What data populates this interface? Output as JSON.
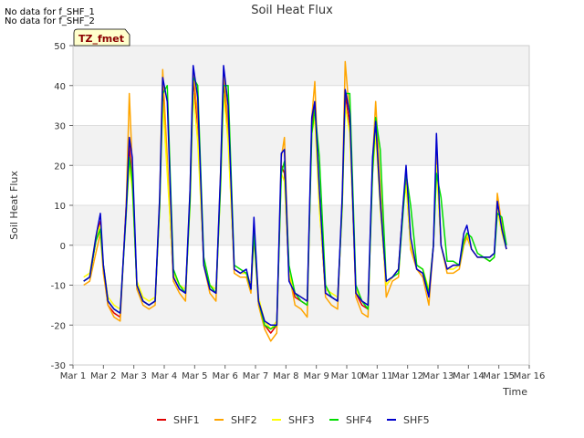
{
  "notices": [
    "No data for f_SHF_1",
    "No data for f_SHF_2"
  ],
  "badge": "TZ_fmet",
  "chart_data": {
    "type": "line",
    "title": "Soil Heat Flux",
    "xlabel": "Time",
    "ylabel": "Soil Heat Flux",
    "xlim": [
      1,
      16
    ],
    "ylim": [
      -30,
      50
    ],
    "xticks": [
      1,
      2,
      3,
      4,
      5,
      6,
      7,
      8,
      9,
      10,
      11,
      12,
      13,
      14,
      15,
      16
    ],
    "xtick_labels": [
      "Mar 1",
      "Mar 2",
      "Mar 3",
      "Mar 4",
      "Mar 5",
      "Mar 6",
      "Mar 7",
      "Mar 8",
      "Mar 9",
      "Mar 10",
      "Mar 11",
      "Mar 12",
      "Mar 13",
      "Mar 14",
      "Mar 15",
      "Mar 16"
    ],
    "yticks": [
      -30,
      -20,
      -10,
      0,
      10,
      20,
      30,
      40,
      50
    ],
    "ytick_labels": [
      "-30",
      "-20",
      "-10",
      "0",
      "10",
      "20",
      "30",
      "40",
      "50"
    ],
    "grid": true,
    "legend_position": "bottom",
    "x": [
      1.35,
      1.55,
      1.75,
      1.9,
      2.0,
      2.15,
      2.35,
      2.55,
      2.75,
      2.85,
      2.95,
      3.1,
      3.3,
      3.5,
      3.7,
      3.85,
      3.95,
      4.1,
      4.3,
      4.5,
      4.7,
      4.85,
      4.95,
      5.1,
      5.3,
      5.5,
      5.7,
      5.85,
      5.95,
      6.1,
      6.3,
      6.5,
      6.7,
      6.85,
      6.95,
      7.1,
      7.3,
      7.5,
      7.7,
      7.85,
      7.95,
      8.1,
      8.3,
      8.5,
      8.7,
      8.85,
      8.95,
      9.1,
      9.3,
      9.5,
      9.7,
      9.85,
      9.95,
      10.1,
      10.3,
      10.5,
      10.7,
      10.85,
      10.95,
      11.1,
      11.3,
      11.5,
      11.7,
      11.85,
      11.95,
      12.1,
      12.3,
      12.5,
      12.7,
      12.85,
      12.95,
      13.1,
      13.3,
      13.5,
      13.7,
      13.85,
      13.95,
      14.1,
      14.3,
      14.5,
      14.7,
      14.85,
      14.95,
      15.1,
      15.25
    ],
    "series": [
      {
        "name": "SHF1",
        "color": "#e00000",
        "values": [
          -9,
          -8,
          1,
          6,
          -6,
          -15,
          -17,
          -18,
          10,
          25,
          16,
          -10,
          -14,
          -15,
          -14,
          10,
          40,
          20,
          -8,
          -11,
          -12,
          12,
          42,
          30,
          -5,
          -11,
          -12,
          16,
          42,
          28,
          -6,
          -7,
          -7,
          -10,
          5,
          -14,
          -20,
          -22,
          -20,
          20,
          18,
          -8,
          -13,
          -14,
          -15,
          30,
          36,
          10,
          -12,
          -13,
          -14,
          10,
          38,
          30,
          -12,
          -15,
          -16,
          20,
          30,
          10,
          -10,
          -8,
          -6,
          10,
          16,
          0,
          -6,
          -7,
          -12,
          0,
          22,
          0,
          -6,
          -5,
          -5,
          1,
          3,
          -1,
          -3,
          -3,
          -3,
          -2,
          10,
          4,
          -1
        ]
      },
      {
        "name": "SHF2",
        "color": "#ffa500",
        "values": [
          -10,
          -9,
          -2,
          3,
          -7,
          -15,
          -18,
          -19,
          10,
          38,
          20,
          -11,
          -15,
          -16,
          -15,
          12,
          44,
          22,
          -9,
          -12,
          -14,
          14,
          44,
          32,
          -5,
          -12,
          -14,
          18,
          44,
          30,
          -7,
          -8,
          -8,
          -12,
          2,
          -15,
          -21,
          -24,
          -22,
          22,
          27,
          -7,
          -15,
          -16,
          -18,
          32,
          41,
          12,
          -13,
          -15,
          -16,
          12,
          46,
          32,
          -13,
          -17,
          -18,
          21,
          36,
          15,
          -13,
          -9,
          -8,
          10,
          18,
          -1,
          -6,
          -8,
          -15,
          0,
          24,
          0,
          -7,
          -7,
          -6,
          0,
          2,
          -1,
          -3,
          -3,
          -4,
          -3,
          13,
          5,
          -1
        ]
      },
      {
        "name": "SHF3",
        "color": "#ffff00",
        "values": [
          -8,
          -7,
          2,
          5,
          -5,
          -13,
          -15,
          -16,
          8,
          20,
          14,
          -9,
          -13,
          -14,
          -13,
          9,
          36,
          18,
          -7,
          -10,
          -11,
          10,
          38,
          26,
          -4,
          -10,
          -11,
          14,
          38,
          26,
          -6,
          -7,
          -7,
          -10,
          4,
          -13,
          -19,
          -21,
          -19,
          18,
          16,
          -7,
          -12,
          -13,
          -14,
          28,
          32,
          9,
          -11,
          -12,
          -13,
          9,
          35,
          28,
          -11,
          -14,
          -15,
          18,
          28,
          9,
          -10,
          -8,
          -6,
          9,
          15,
          0,
          -5,
          -6,
          -11,
          0,
          20,
          0,
          -6,
          -6,
          -5,
          1,
          3,
          -1,
          -3,
          -3,
          -3,
          -2,
          9,
          3,
          -1
        ]
      },
      {
        "name": "SHF4",
        "color": "#00dd00",
        "values": [
          -9,
          -8,
          1,
          4,
          -5,
          -14,
          -16,
          -17,
          8,
          22,
          16,
          -10,
          -14,
          -15,
          -14,
          10,
          38,
          40,
          -6,
          -10,
          -12,
          11,
          42,
          40,
          -3,
          -10,
          -12,
          15,
          40,
          40,
          -5,
          -6,
          -7,
          -11,
          3,
          -14,
          -20,
          -21,
          -20,
          18,
          21,
          -5,
          -12,
          -14,
          -15,
          28,
          34,
          22,
          -10,
          -13,
          -14,
          10,
          38,
          38,
          -10,
          -14,
          -16,
          18,
          32,
          24,
          -9,
          -8,
          -7,
          8,
          18,
          10,
          -5,
          -6,
          -12,
          0,
          18,
          12,
          -4,
          -4,
          -5,
          1,
          3,
          2,
          -2,
          -3,
          -4,
          -3,
          8,
          7,
          0
        ]
      },
      {
        "name": "SHF5",
        "color": "#0000cc",
        "values": [
          -9,
          -8,
          2,
          8,
          -5,
          -14,
          -16,
          -17,
          9,
          27,
          22,
          -10,
          -14,
          -15,
          -14,
          12,
          42,
          36,
          -8,
          -11,
          -12,
          14,
          45,
          37,
          -5,
          -11,
          -12,
          18,
          45,
          35,
          -6,
          -7,
          -6,
          -11,
          7,
          -14,
          -19,
          -20,
          -20,
          23,
          24,
          -9,
          -12,
          -13,
          -14,
          32,
          36,
          14,
          -12,
          -13,
          -14,
          12,
          39,
          33,
          -12,
          -14,
          -15,
          22,
          31,
          11,
          -9,
          -8,
          -6,
          10,
          20,
          2,
          -6,
          -7,
          -13,
          0,
          28,
          0,
          -6,
          -5,
          -5,
          3,
          5,
          -1,
          -3,
          -3,
          -3,
          -2,
          11,
          4,
          -1
        ]
      }
    ]
  }
}
